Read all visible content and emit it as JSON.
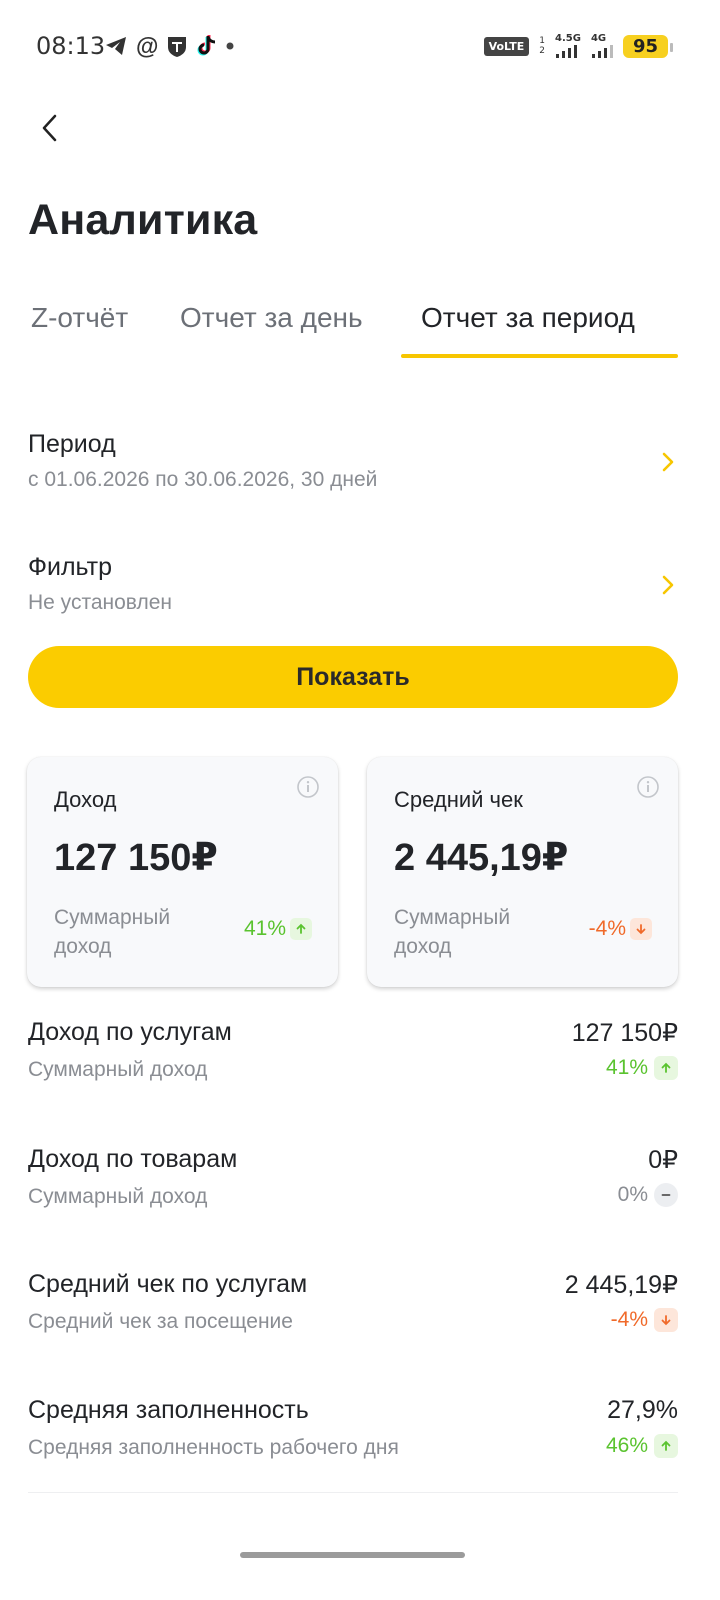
{
  "status_bar": {
    "time": "08:13",
    "volte": "VoLTE",
    "sim_top": "1",
    "sim_bottom": "2",
    "net1": "4.5G",
    "net2": "4G",
    "battery": "95"
  },
  "header": {
    "title": "Аналитика"
  },
  "tabs": [
    {
      "label": "Z-отчёт"
    },
    {
      "label": "Отчет за день"
    },
    {
      "label": "Отчет за период"
    }
  ],
  "period": {
    "title": "Период",
    "value": "с 01.06.2026 по 30.06.2026, 30 дней"
  },
  "filter": {
    "title": "Фильтр",
    "value": "Не установлен"
  },
  "show_button": "Показать",
  "cards": [
    {
      "title": "Доход",
      "value": "127 150₽",
      "desc": "Суммарный доход",
      "change": "41%"
    },
    {
      "title": "Средний чек",
      "value": "2 445,19₽",
      "desc": "Суммарный доход",
      "change": "-4%"
    }
  ],
  "metrics": [
    {
      "title": "Доход по услугам",
      "subtitle": "Суммарный доход",
      "value": "127 150₽",
      "change": "41%"
    },
    {
      "title": "Доход по товарам",
      "subtitle": "Суммарный доход",
      "value": "0₽",
      "change": "0%"
    },
    {
      "title": "Средний чек по услугам",
      "subtitle": "Средний чек за посещение",
      "value": "2 445,19₽",
      "change": "-4%"
    },
    {
      "title": "Средняя заполненность",
      "subtitle": "Средняя заполненность рабочего дня",
      "value": "27,9%",
      "change": "46%"
    }
  ],
  "colors": {
    "accent": "#fbcc00",
    "positive": "#5ac32f",
    "negative": "#f06a2a",
    "neutral": "#8a8d93"
  }
}
